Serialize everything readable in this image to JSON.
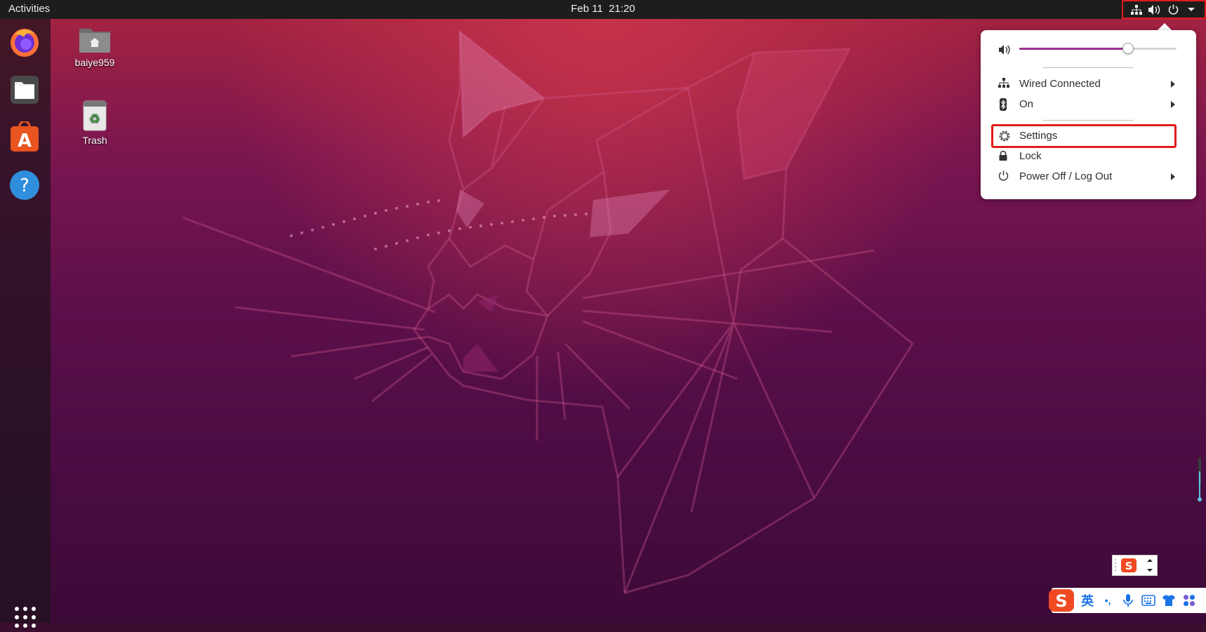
{
  "topbar": {
    "activities": "Activities",
    "date": "Feb 11",
    "time": "21:20",
    "tray_icons": [
      "network-icon",
      "volume-icon",
      "power-icon",
      "chevron-down-icon"
    ]
  },
  "dock": {
    "items": [
      "firefox-icon",
      "files-icon",
      "software-icon",
      "help-icon"
    ],
    "show_apps": "grid-icon"
  },
  "desktop": {
    "icons": [
      {
        "label": "baiye959",
        "icon": "home-folder-icon"
      },
      {
        "label": "Trash",
        "icon": "trash-icon"
      }
    ]
  },
  "menu": {
    "volume_level": 0.69,
    "items": [
      {
        "label": "Wired Connected",
        "icon": "network-icon",
        "submenu": true
      },
      {
        "label": "On",
        "icon": "bluetooth-icon",
        "submenu": true
      },
      {
        "label": "Settings",
        "icon": "settings-icon",
        "submenu": false,
        "highlighted": true
      },
      {
        "label": "Lock",
        "icon": "lock-icon",
        "submenu": false
      },
      {
        "label": "Power Off / Log Out",
        "icon": "power-icon",
        "submenu": true
      }
    ]
  },
  "ime": {
    "mode": "英",
    "punct": "•,",
    "icons": [
      "sogou-icon",
      "microphone-icon",
      "keyboard-icon",
      "skin-icon",
      "apps-icon"
    ]
  },
  "colors": {
    "accent": "#9a2f8f",
    "highlight_box": "#e21a1a",
    "topbar": "#1d1d1d"
  }
}
